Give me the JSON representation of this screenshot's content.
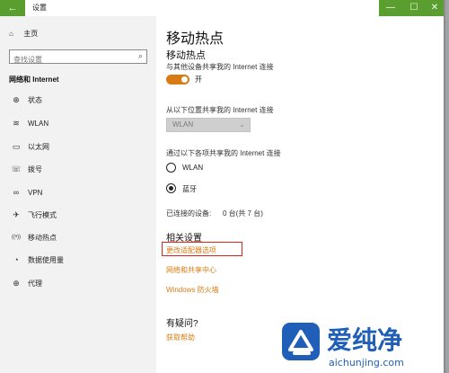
{
  "window": {
    "title": "设置",
    "back_glyph": "←",
    "controls": [
      "—",
      "☐",
      "✕"
    ]
  },
  "sidebar": {
    "home_label": "主页",
    "search_placeholder": "查找设置",
    "section_title": "网络和 Internet",
    "items": [
      {
        "label": "状态",
        "icon": "globe-icon",
        "glyph": "⊕"
      },
      {
        "label": "WLAN",
        "icon": "wifi-icon",
        "glyph": "≋"
      },
      {
        "label": "以太网",
        "icon": "monitor-icon",
        "glyph": "▭"
      },
      {
        "label": "拨号",
        "icon": "phone-icon",
        "glyph": "☏"
      },
      {
        "label": "VPN",
        "icon": "vpn-icon",
        "glyph": "∞"
      },
      {
        "label": "飞行模式",
        "icon": "airplane-icon",
        "glyph": "✈"
      },
      {
        "label": "移动热点",
        "icon": "hotspot-icon",
        "glyph": "((•))"
      },
      {
        "label": "数据使用量",
        "icon": "data-usage-icon",
        "glyph": "◔"
      },
      {
        "label": "代理",
        "icon": "proxy-icon",
        "glyph": "⊕"
      }
    ]
  },
  "main": {
    "page_title": "移动热点",
    "hotspot_heading": "移动热点",
    "share_desc": "与其他设备共享我的 Internet 连接",
    "toggle_state": "开",
    "toggle_on": true,
    "share_from_label": "从以下位置共享我的 Internet 连接",
    "share_from_value": "WLAN",
    "share_over_label": "通过以下各项共享我的 Internet 连接",
    "radio_options": [
      {
        "label": "WLAN",
        "selected": false
      },
      {
        "label": "蓝牙",
        "selected": true
      }
    ],
    "connected_label": "已连接的设备:",
    "connected_value": "0 台(共 7 台)",
    "related_heading": "相关设置",
    "links": [
      "更改适配器选项",
      "网络和共享中心",
      "Windows 防火墙"
    ],
    "question_heading": "有疑问?",
    "help_link": "获取帮助"
  },
  "watermark": {
    "text": "爱纯净",
    "url": "aichunjing.com"
  },
  "colors": {
    "accent": "#d97b14",
    "titlebar_green": "#5a9e2f",
    "highlight_red": "#d9251d",
    "watermark_blue": "#1f5fb8"
  }
}
